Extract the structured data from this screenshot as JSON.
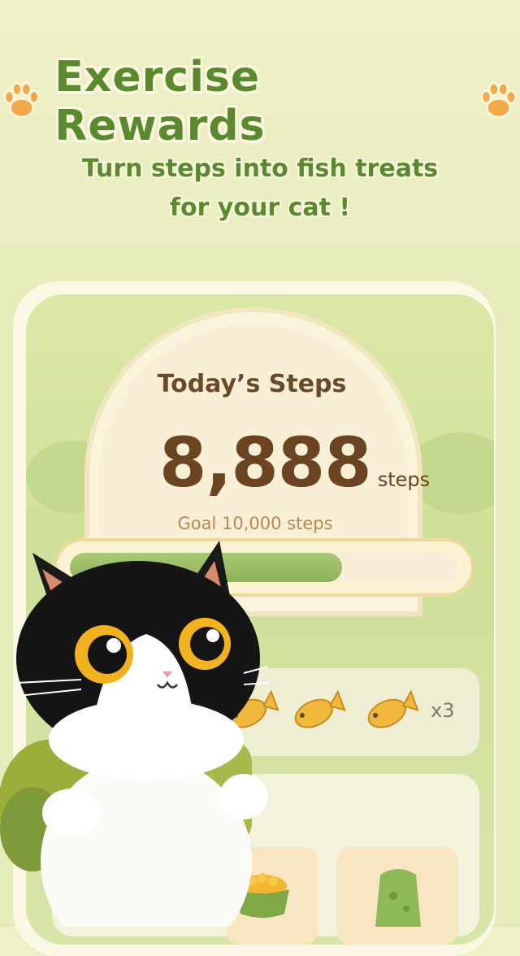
{
  "header": {
    "title": "Exercise Rewards",
    "subtitle_line1": "Turn steps into fish treats",
    "subtitle_line2": "for your cat !"
  },
  "steps": {
    "label": "Today’s Steps",
    "value": "8,888",
    "unit": "steps",
    "goal_text": "Goal 10,000 steps",
    "progress": 0.7
  },
  "rewards": {
    "fish_count": "x3",
    "fish_icon": "fish-treat-icon"
  },
  "colors": {
    "accent_green": "#5b8a2e",
    "progress_green": "#8cb25a",
    "step_brown": "#6b4421"
  }
}
